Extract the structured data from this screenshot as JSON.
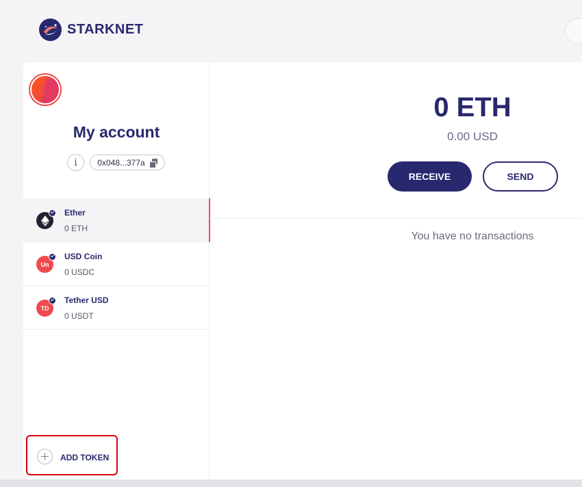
{
  "header": {
    "brand": "STARKNET",
    "logo_icon": "starknet-logo-icon"
  },
  "account": {
    "name": "My account",
    "info_label": "i",
    "address": "0x048...377a"
  },
  "tokens": [
    {
      "name": "Ether",
      "balance": "0 ETH",
      "icon": "ethereum-icon",
      "icon_text": "",
      "active": true
    },
    {
      "name": "USD Coin",
      "balance": "0 USDC",
      "icon": "usdc-icon",
      "icon_text": "Un",
      "active": false
    },
    {
      "name": "Tether USD",
      "balance": "0 USDT",
      "icon": "usdt-icon",
      "icon_text": "TD",
      "active": false
    }
  ],
  "add_token": {
    "label": "ADD TOKEN"
  },
  "main": {
    "balance": "0 ETH",
    "balance_usd": "0.00 USD",
    "receive_label": "RECEIVE",
    "send_label": "SEND",
    "empty_message": "You have no transactions"
  },
  "colors": {
    "primary": "#28286e",
    "accent": "#ef4a4f",
    "highlight_border": "#d4000a"
  }
}
